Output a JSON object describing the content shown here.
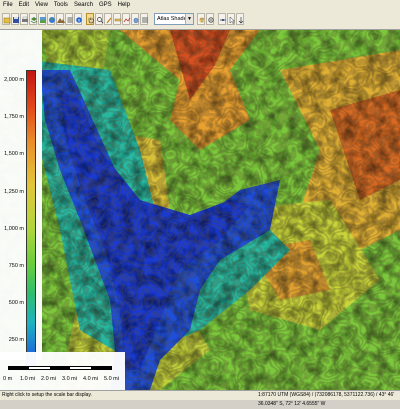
{
  "menu": [
    "File",
    "Edit",
    "View",
    "Tools",
    "Search",
    "GPS",
    "Help"
  ],
  "toolbar": {
    "shader_value": "Atlas Shader",
    "dropdown_arrow": "▼"
  },
  "legend": {
    "labels": [
      "2,000 m",
      "1,750 m",
      "1,500 m",
      "1,250 m",
      "1,000 m",
      "750 m",
      "500 m",
      "250 m",
      "0 m"
    ]
  },
  "scale": {
    "labels": [
      "0 m",
      "1.0 mi",
      "2.0 mi",
      "3.0 mi",
      "4.0 mi",
      "5.0 mi"
    ]
  },
  "status": {
    "hint": "Right click to setup the scale bar display.",
    "coords": "1:87170  UTM (WGS84) / (732086178, 5371122.736) / 43° 46' 36.0348\" S, 72° 12' 4.6555\" W"
  },
  "colors": {
    "low": "#1a3ad8",
    "high": "#c81010",
    "ui_chrome": "#ece9d8"
  }
}
